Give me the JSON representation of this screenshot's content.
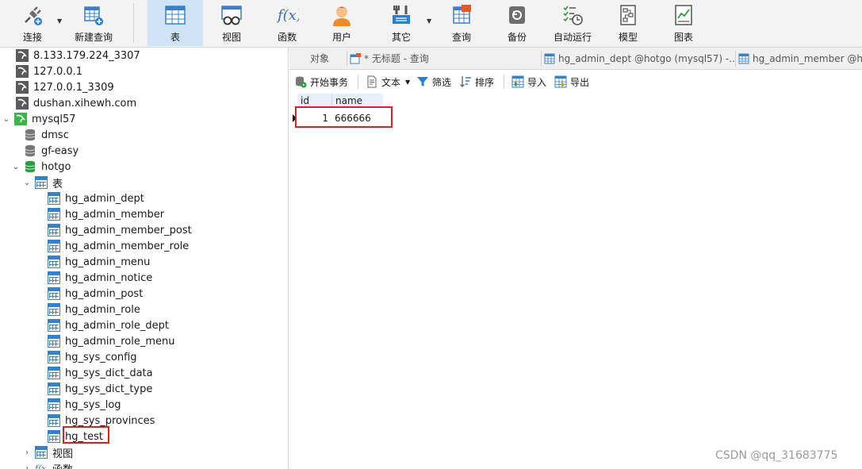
{
  "toolbar": {
    "connect": "连接",
    "new_query": "新建查询",
    "table": "表",
    "view": "视图",
    "function": "函数",
    "user": "用户",
    "other": "其它",
    "query": "查询",
    "backup": "备份",
    "automation": "自动运行",
    "model": "模型",
    "chart": "图表"
  },
  "tree": {
    "connections": [
      "8.133.179.224_3307",
      "127.0.0.1",
      "127.0.0.1_3309",
      "dushan.xihewh.com"
    ],
    "server": "mysql57",
    "databases": [
      "dmsc",
      "gf-easy",
      "hotgo"
    ],
    "tables_folder": "表",
    "tables": [
      "hg_admin_dept",
      "hg_admin_member",
      "hg_admin_member_post",
      "hg_admin_member_role",
      "hg_admin_menu",
      "hg_admin_notice",
      "hg_admin_post",
      "hg_admin_role",
      "hg_admin_role_dept",
      "hg_admin_role_menu",
      "hg_sys_config",
      "hg_sys_dict_data",
      "hg_sys_dict_type",
      "hg_sys_log",
      "hg_sys_provinces",
      "hg_test"
    ],
    "views_folder": "视图",
    "functions_folder": "函数"
  },
  "tabs": {
    "objects": "对象",
    "untitled_query": "* 无标题 - 查询",
    "tab_dept": "hg_admin_dept @hotgo (mysql57) -...",
    "tab_member": "hg_admin_member @ho"
  },
  "subtoolbar": {
    "begin_transaction": "开始事务",
    "text": "文本",
    "filter": "筛选",
    "sort": "排序",
    "import": "导入",
    "export": "导出"
  },
  "grid": {
    "columns": [
      "id",
      "name"
    ],
    "rows": [
      [
        "1",
        "666666"
      ]
    ]
  },
  "watermark": "CSDN @qq_31683775",
  "colors": {
    "accent": "#3b7fc4",
    "highlight_box": "#e02020",
    "active_tool": "#cfe4f7"
  }
}
